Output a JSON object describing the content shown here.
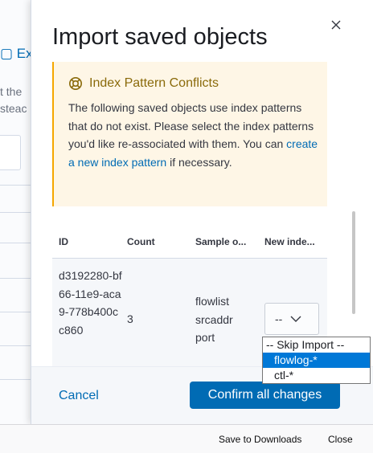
{
  "background": {
    "link_text": "Ex",
    "text_line1": "t the",
    "text_line2": "steac"
  },
  "flyout": {
    "title": "Import saved objects",
    "callout": {
      "icon": "lifebuoy-icon",
      "title": "Index Pattern Conflicts",
      "body_before_link": "The following saved objects use index patterns that do not exist. Please select the index patterns you'd like re-associated with them. You can ",
      "link_text": "create a new index pattern",
      "body_after_link": " if necessary."
    },
    "table": {
      "columns": [
        "ID",
        "Count",
        "Sample o...",
        "New inde..."
      ],
      "rows": [
        {
          "id": "d3192280-bf66-11e9-aca9-778b400cc860",
          "count": "3",
          "sample": [
            "flowlist",
            "srcaddr",
            "port"
          ],
          "new_index_value": "--"
        }
      ]
    },
    "footer": {
      "cancel_label": "Cancel",
      "confirm_label": "Confirm all changes"
    }
  },
  "dropdown": {
    "options": [
      "-- Skip Import --",
      "flowlog-*",
      "ctl-*"
    ],
    "selected_index": 1
  },
  "download_bar": {
    "save_label": "Save to Downloads",
    "close_label": "Close"
  },
  "colors": {
    "primary": "#006bb4",
    "callout_bg": "#fef6e6",
    "callout_title": "#8a6a0a",
    "selection": "#0078d7"
  }
}
